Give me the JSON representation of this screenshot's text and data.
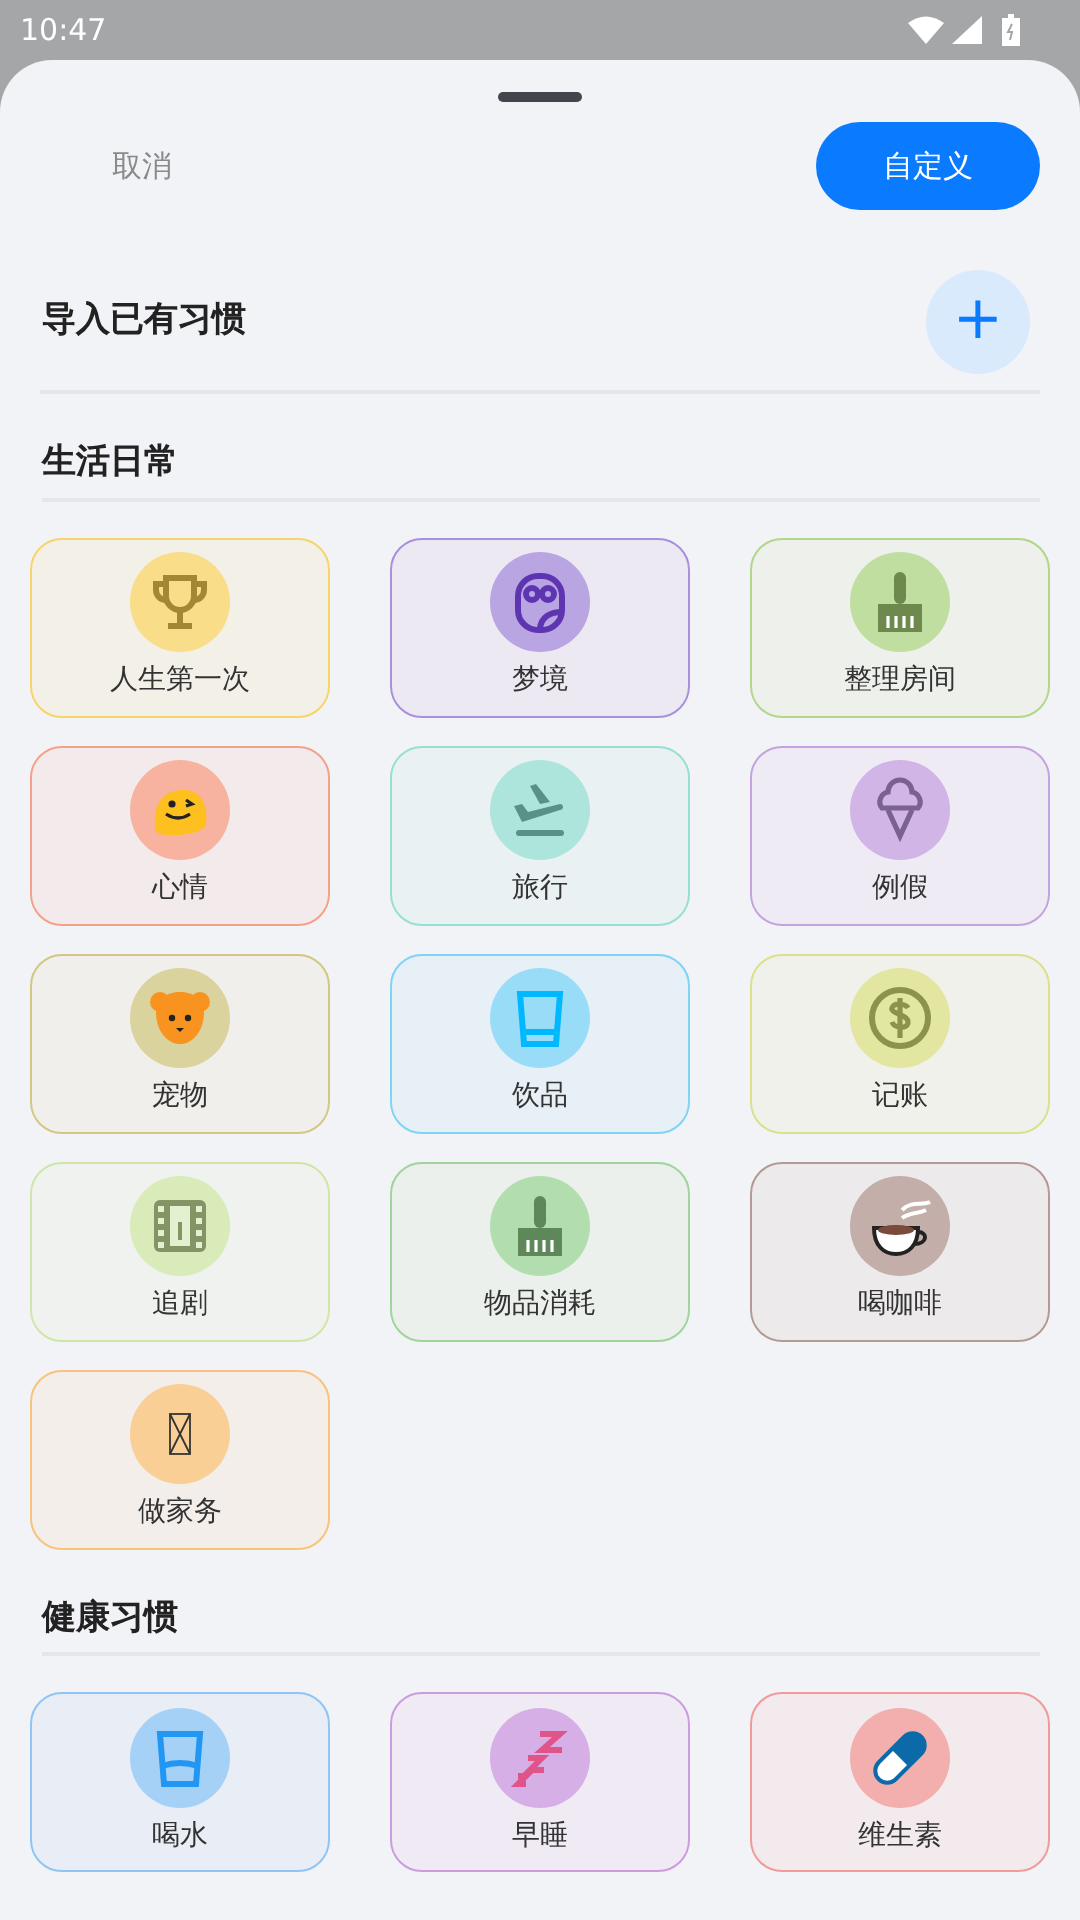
{
  "status_bar": {
    "time": "10:47"
  },
  "header": {
    "cancel": "取消",
    "custom_button": "自定义"
  },
  "import_row": {
    "title": "导入已有习惯",
    "add_button": "+"
  },
  "sections": [
    {
      "title": "生活日常",
      "items": [
        {
          "label": "人生第一次",
          "kind": "trophy",
          "color": "#f7d46b"
        },
        {
          "label": "梦境",
          "kind": "owl",
          "color": "#a98fdc"
        },
        {
          "label": "整理房间",
          "kind": "broom",
          "color": "#b2d68a"
        },
        {
          "label": "心情",
          "kind": "face",
          "color": "#f5a088"
        },
        {
          "label": "旅行",
          "kind": "plane",
          "color": "#98dfd3"
        },
        {
          "label": "例假",
          "kind": "icecream",
          "color": "#c4a3e0"
        },
        {
          "label": "宠物",
          "kind": "dog",
          "color": "#d2c884"
        },
        {
          "label": "饮品",
          "kind": "cup",
          "color": "#7fd3f5"
        },
        {
          "label": "记账",
          "kind": "coin",
          "color": "#dbe08a"
        },
        {
          "label": "追剧",
          "kind": "film",
          "color": "#cfe6a8"
        },
        {
          "label": "物品消耗",
          "kind": "broom",
          "color": "#9fd49a"
        },
        {
          "label": "喝咖啡",
          "kind": "coffee",
          "color": "#b49a94"
        },
        {
          "label": "做家务",
          "kind": "missing",
          "color": "#f8c37c"
        }
      ]
    },
    {
      "title": "健康习惯",
      "items": [
        {
          "label": "喝水",
          "kind": "glass",
          "color": "#8ec5f4"
        },
        {
          "label": "早睡",
          "kind": "zzz",
          "color": "#cc9be0"
        },
        {
          "label": "维生素",
          "kind": "pill",
          "color": "#f09a9a"
        }
      ]
    }
  ]
}
